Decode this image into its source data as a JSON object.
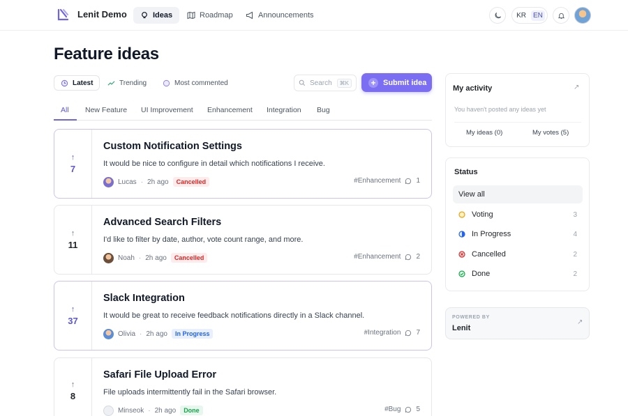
{
  "header": {
    "brand": "Lenit Demo",
    "nav": [
      "Ideas",
      "Roadmap",
      "Announcements"
    ],
    "lang": [
      "KR",
      "EN"
    ],
    "active_lang": "EN"
  },
  "page": {
    "title": "Feature ideas"
  },
  "sort": [
    "Latest",
    "Trending",
    "Most commented"
  ],
  "search": {
    "placeholder": "Search",
    "shortcut": "⌘K"
  },
  "submit_label": "Submit idea",
  "tabs": [
    "All",
    "New Feature",
    "UI Improvement",
    "Enhancement",
    "Integration",
    "Bug"
  ],
  "ideas": [
    {
      "votes": "7",
      "title": "Custom Notification Settings",
      "desc": "It would be nice to configure in detail which notifications I receive.",
      "author": "Lucas",
      "time": "2h ago",
      "status": "Cancelled",
      "tag": "#Enhancement",
      "comments": "1"
    },
    {
      "votes": "11",
      "title": "Advanced Search Filters",
      "desc": "I'd like to filter by date, author, vote count range, and more.",
      "author": "Noah",
      "time": "2h ago",
      "status": "Cancelled",
      "tag": "#Enhancement",
      "comments": "2"
    },
    {
      "votes": "37",
      "title": "Slack Integration",
      "desc": "It would be great to receive feedback notifications directly in a Slack channel.",
      "author": "Olivia",
      "time": "2h ago",
      "status": "In Progress",
      "tag": "#Integration",
      "comments": "7"
    },
    {
      "votes": "8",
      "title": "Safari File Upload Error",
      "desc": "File uploads intermittently fail in the Safari browser.",
      "author": "Minseok",
      "time": "2h ago",
      "status": "Done",
      "tag": "#Bug",
      "comments": "5"
    }
  ],
  "activity": {
    "title": "My activity",
    "empty": "You haven't posted any ideas yet",
    "my_ideas": "My ideas (0)",
    "my_votes": "My votes (5)"
  },
  "status_panel": {
    "title": "Status",
    "view_all": "View all",
    "items": [
      {
        "label": "Voting",
        "count": "3"
      },
      {
        "label": "In Progress",
        "count": "4"
      },
      {
        "label": "Cancelled",
        "count": "2"
      },
      {
        "label": "Done",
        "count": "2"
      }
    ]
  },
  "powered": {
    "label": "POWERED BY",
    "name": "Lenit"
  },
  "colors": {
    "accent": "#7c6ef2",
    "cancelled": "#dc2626",
    "in_progress": "#2563eb",
    "done": "#16a34a",
    "voting": "#f59e0b"
  }
}
